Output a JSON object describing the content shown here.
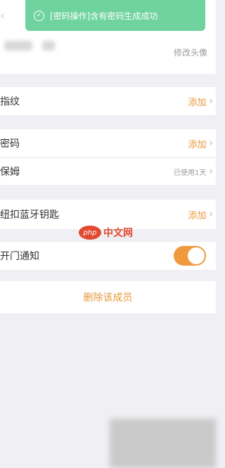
{
  "toast": {
    "icon": "check-circle-icon",
    "message": "[密码操作]含有密码生成成功"
  },
  "header": {
    "back_icon": "back-arrow-icon",
    "avatar_edit_label": "修改头像"
  },
  "fingerprint": {
    "label": "指纹",
    "action": "添加"
  },
  "password": {
    "label": "密码",
    "action": "添加"
  },
  "nanny": {
    "label": "保姆",
    "status": "已使用1天"
  },
  "bluetooth_key": {
    "label": "纽扣蓝牙钥匙",
    "action": "添加"
  },
  "door_notify": {
    "label": "开门通知",
    "enabled": true
  },
  "delete": {
    "label": "删除该成员"
  },
  "watermark": {
    "logo": "php",
    "text": "中文网"
  },
  "colors": {
    "accent": "#e79a3c",
    "toggle_on": "#f0993d",
    "toast_bg": "#6fd3a0",
    "background": "#efeff4"
  }
}
